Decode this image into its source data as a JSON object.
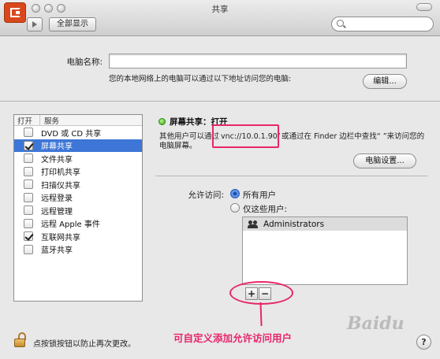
{
  "window": {
    "title": "共享"
  },
  "toolbar": {
    "show_all_label": "全部显示",
    "search_placeholder": ""
  },
  "computer": {
    "name_label": "电脑名称:",
    "name_value": "",
    "hint": "您的本地网络上的电脑可以通过以下地址访问您的电脑:",
    "edit_label": "编辑..."
  },
  "services": {
    "header_on": "打开",
    "header_service": "服务",
    "items": [
      {
        "label": "DVD 或 CD 共享",
        "checked": false,
        "selected": false
      },
      {
        "label": "屏幕共享",
        "checked": true,
        "selected": true
      },
      {
        "label": "文件共享",
        "checked": false,
        "selected": false
      },
      {
        "label": "打印机共享",
        "checked": false,
        "selected": false
      },
      {
        "label": "扫描仪共享",
        "checked": false,
        "selected": false
      },
      {
        "label": "远程登录",
        "checked": false,
        "selected": false
      },
      {
        "label": "远程管理",
        "checked": false,
        "selected": false
      },
      {
        "label": "远程 Apple 事件",
        "checked": false,
        "selected": false
      },
      {
        "label": "互联网共享",
        "checked": true,
        "selected": false
      },
      {
        "label": "蓝牙共享",
        "checked": false,
        "selected": false
      }
    ]
  },
  "detail": {
    "status": "屏幕共享：打开",
    "desc_prefix": "其他用户可以通过",
    "desc_url": "vnc://10.0.1.90/",
    "desc_suffix": "或通过在 Finder 边栏中查找“     ”来访问您的电脑屏幕。",
    "computer_settings_label": "电脑设置...",
    "allow_label": "允许访问:",
    "radio_all": "所有用户",
    "radio_some": "仅这些用户:",
    "users": [
      "Administrators"
    ],
    "add_label": "+",
    "remove_label": "−"
  },
  "annotation": {
    "text": "可自定义添加允许访问用户"
  },
  "lock": {
    "text": "点按锁按钮以防止再次更改。"
  },
  "watermark": "Baidu",
  "help_label": "?"
}
